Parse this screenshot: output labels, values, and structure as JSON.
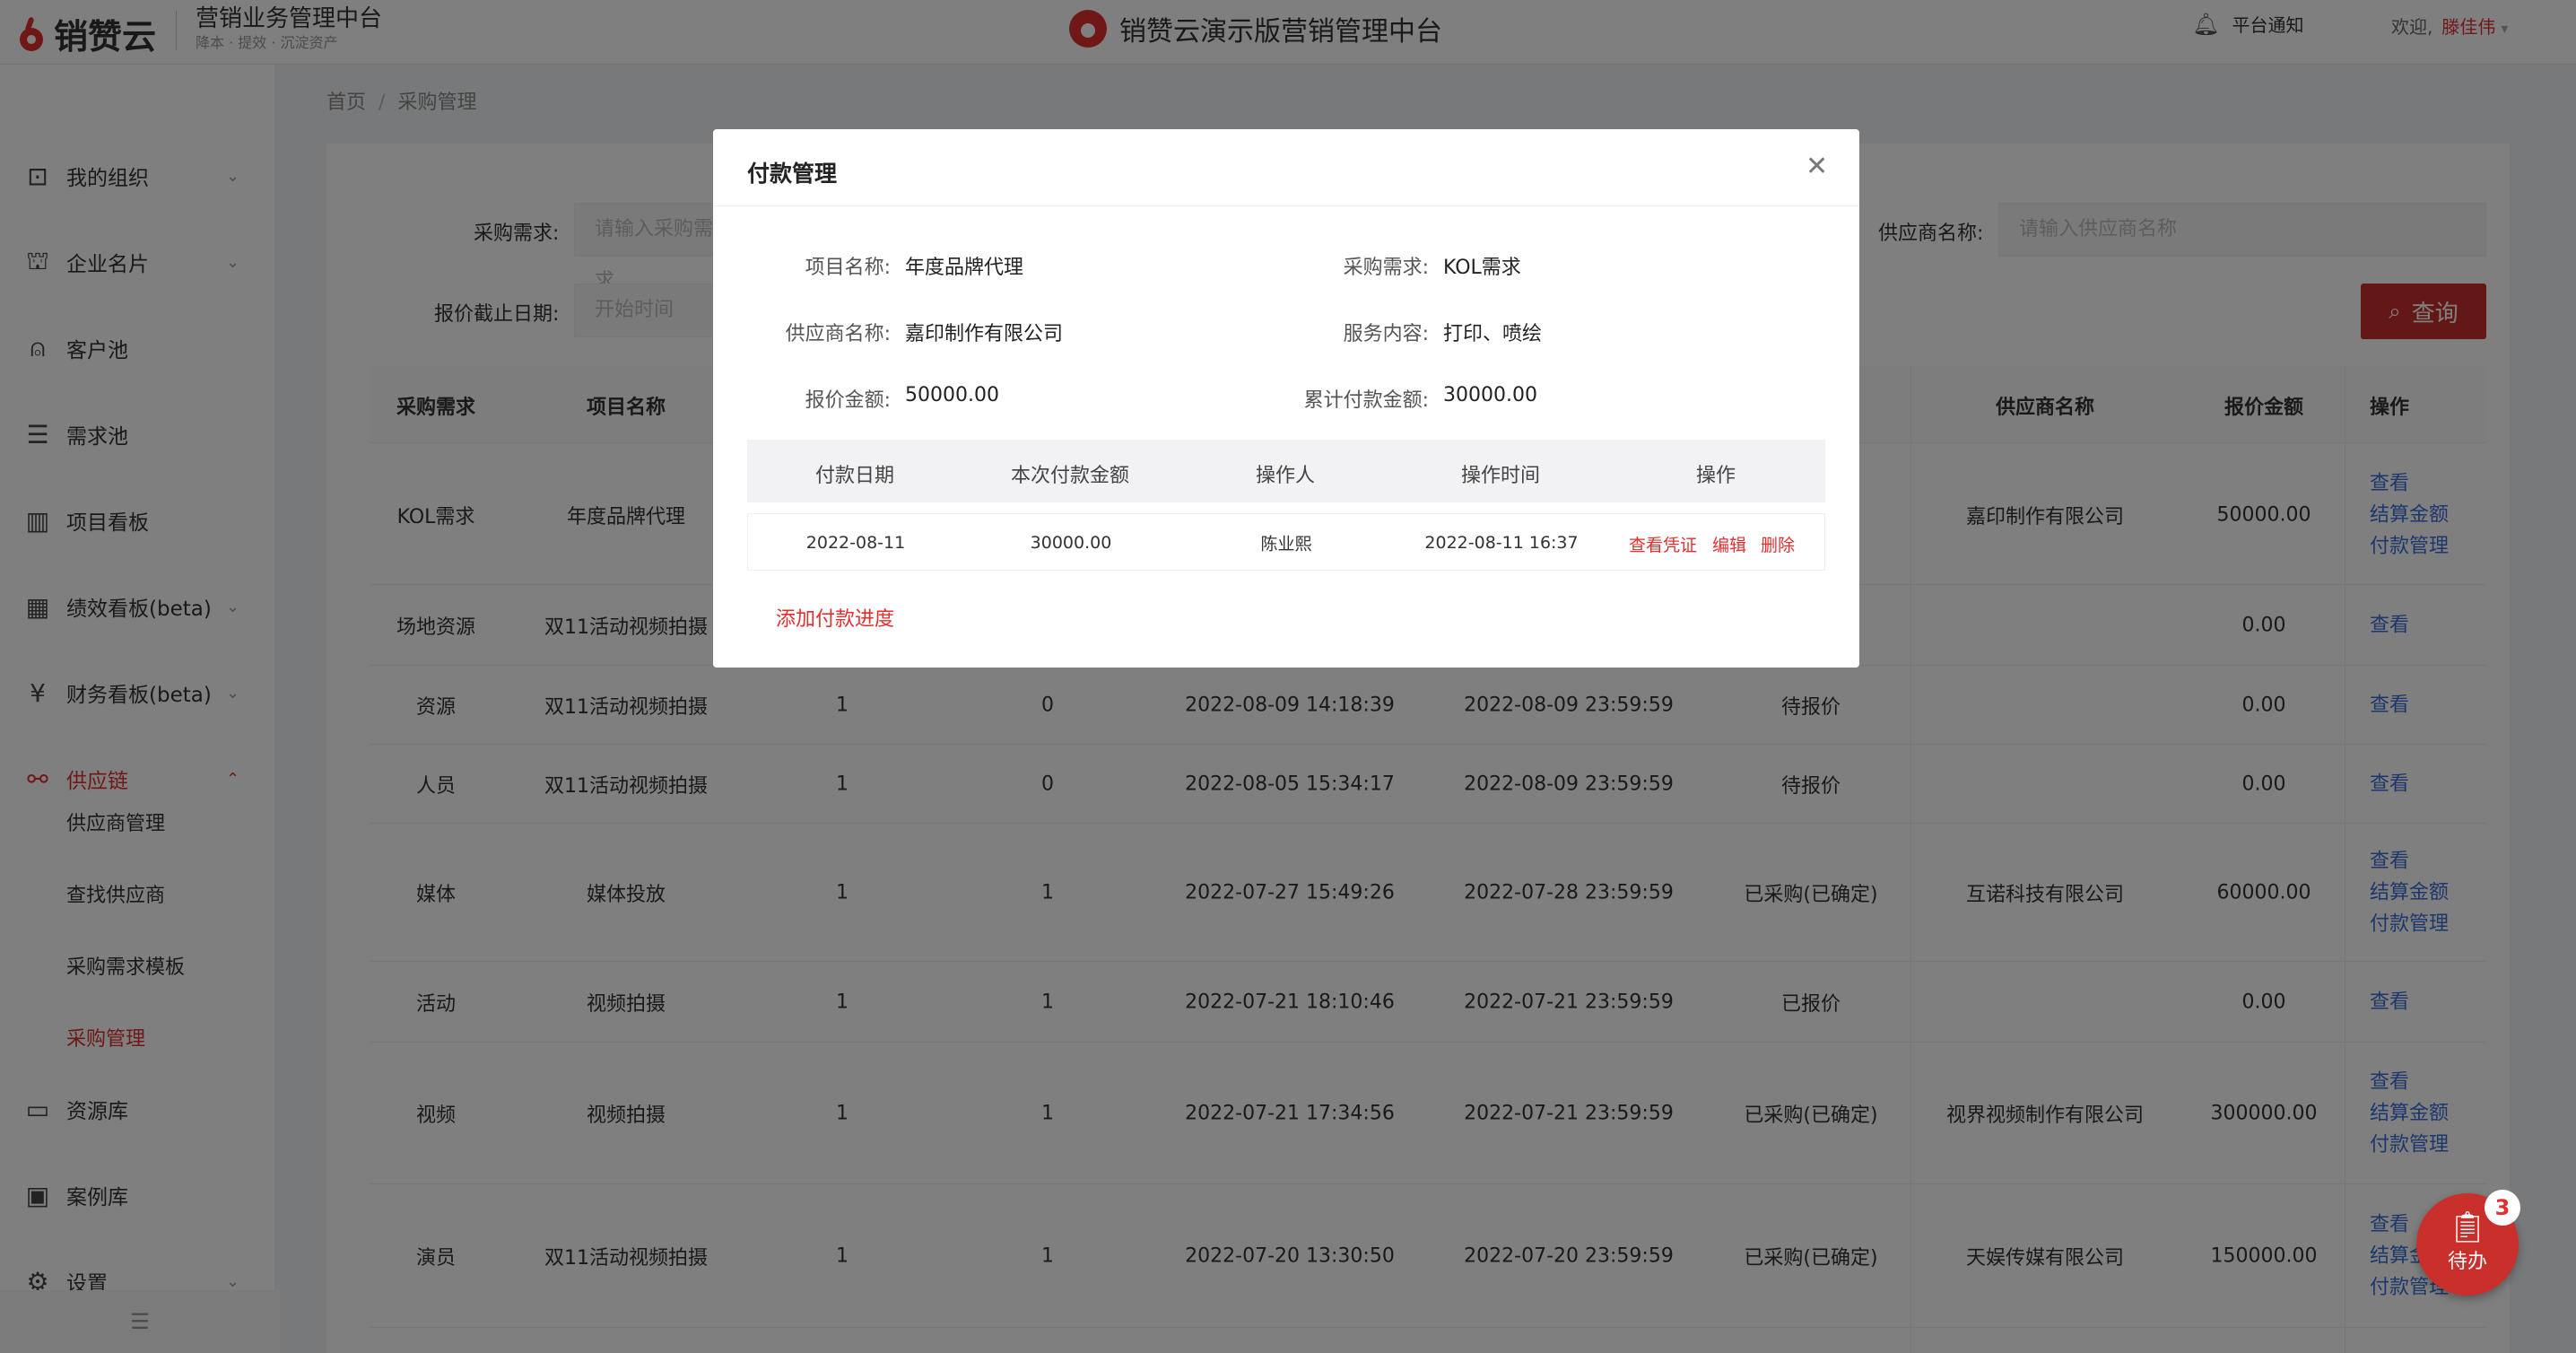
{
  "header": {
    "logo_text": "销赞云",
    "platform_title": "营销业务管理中台",
    "platform_slogan": "降本 · 提效 · 沉淀资产",
    "center_title": "销赞云演示版营销管理中台",
    "notice_label": "平台通知",
    "welcome_prefix": "欢迎,",
    "user_name": "滕佳伟"
  },
  "sidebar": {
    "items": [
      {
        "label": "我的组织",
        "icon": "org-icon",
        "glyph": "⊡"
      },
      {
        "label": "企业名片",
        "icon": "building-icon",
        "glyph": "⛫"
      },
      {
        "label": "客户池",
        "icon": "user-icon",
        "glyph": "⍝"
      },
      {
        "label": "需求池",
        "icon": "list-icon",
        "glyph": "☰"
      },
      {
        "label": "项目看板",
        "icon": "board-icon",
        "glyph": "▥"
      },
      {
        "label": "绩效看板(beta)",
        "icon": "chart-icon",
        "glyph": "▦"
      },
      {
        "label": "财务看板(beta)",
        "icon": "yen-icon",
        "glyph": "¥"
      },
      {
        "label": "供应链",
        "icon": "chain-icon",
        "glyph": "⚯"
      }
    ],
    "sub_items": [
      "供应商管理",
      "查找供应商",
      "采购需求模板",
      "采购管理"
    ],
    "bottom_items": [
      {
        "label": "资源库",
        "icon": "folder-icon",
        "glyph": "▭"
      },
      {
        "label": "案例库",
        "icon": "case-icon",
        "glyph": "▣"
      },
      {
        "label": "设置",
        "icon": "gear-icon",
        "glyph": "⚙"
      }
    ]
  },
  "breadcrumb": {
    "home": "首页",
    "sep": "/",
    "current": "采购管理"
  },
  "filters": {
    "demand_label": "采购需求:",
    "demand_placeholder": "请输入采购需求",
    "supplier_label": "供应商名称:",
    "supplier_placeholder": "请输入供应商名称",
    "deadline_label": "报价截止日期:",
    "start_placeholder": "开始时间",
    "query_button": "查询"
  },
  "table": {
    "headers": [
      "采购需求",
      "项目名称",
      "",
      "",
      "",
      "",
      "",
      "供应商名称",
      "报价金额",
      "操作"
    ],
    "rows": [
      {
        "c": [
          "KOL需求",
          "年度品牌代理",
          "",
          "",
          "",
          "",
          "定)",
          "嘉印制作有限公司",
          "50000.00"
        ],
        "actions": [
          "查看",
          "结算金额",
          "付款管理"
        ]
      },
      {
        "c": [
          "场地资源",
          "双11活动视频拍摄",
          "",
          "",
          "",
          "",
          "",
          "",
          "0.00"
        ],
        "actions": [
          "查看"
        ]
      },
      {
        "c": [
          "资源",
          "双11活动视频拍摄",
          "1",
          "0",
          "2022-08-09 14:18:39",
          "2022-08-09 23:59:59",
          "待报价",
          "",
          "0.00"
        ],
        "actions": [
          "查看"
        ]
      },
      {
        "c": [
          "人员",
          "双11活动视频拍摄",
          "1",
          "0",
          "2022-08-05 15:34:17",
          "2022-08-09 23:59:59",
          "待报价",
          "",
          "0.00"
        ],
        "actions": [
          "查看"
        ]
      },
      {
        "c": [
          "媒体",
          "媒体投放",
          "1",
          "1",
          "2022-07-27 15:49:26",
          "2022-07-28 23:59:59",
          "已采购(已确定)",
          "互诺科技有限公司",
          "60000.00"
        ],
        "actions": [
          "查看",
          "结算金额",
          "付款管理"
        ]
      },
      {
        "c": [
          "活动",
          "视频拍摄",
          "1",
          "1",
          "2022-07-21 18:10:46",
          "2022-07-21 23:59:59",
          "已报价",
          "",
          "0.00"
        ],
        "actions": [
          "查看"
        ]
      },
      {
        "c": [
          "视频",
          "视频拍摄",
          "1",
          "1",
          "2022-07-21 17:34:56",
          "2022-07-21 23:59:59",
          "已采购(已确定)",
          "视界视频制作有限公司",
          "300000.00"
        ],
        "actions": [
          "查看",
          "结算金额",
          "付款管理"
        ]
      },
      {
        "c": [
          "演员",
          "双11活动视频拍摄",
          "1",
          "1",
          "2022-07-20 13:30:50",
          "2022-07-20 23:59:59",
          "已采购(已确定)",
          "天娱传媒有限公司",
          "150000.00"
        ],
        "actions": [
          "查看",
          "结算金额",
          "付款管理"
        ]
      }
    ]
  },
  "modal": {
    "title": "付款管理",
    "info": {
      "project_label": "项目名称:",
      "project_value": "年度品牌代理",
      "demand_label": "采购需求:",
      "demand_value": "KOL需求",
      "supplier_label": "供应商名称:",
      "supplier_value": "嘉印制作有限公司",
      "service_label": "服务内容:",
      "service_value": "打印、喷绘",
      "quote_label": "报价金额:",
      "quote_value": "50000.00",
      "paid_label": "累计付款金额:",
      "paid_value": "30000.00"
    },
    "pay_table": {
      "headers": [
        "付款日期",
        "本次付款金额",
        "操作人",
        "操作时间",
        "操作"
      ],
      "rows": [
        {
          "date": "2022-08-11",
          "amount": "30000.00",
          "operator": "陈业熙",
          "time": "2022-08-11 16:37",
          "actions": [
            "查看凭证",
            "编辑",
            "删除"
          ]
        }
      ]
    },
    "add_link": "添加付款进度"
  },
  "fab": {
    "label": "待办",
    "badge": "3"
  },
  "colors": {
    "brand": "#e0302f",
    "link": "#3a6fd8",
    "button": "#c9302c"
  }
}
